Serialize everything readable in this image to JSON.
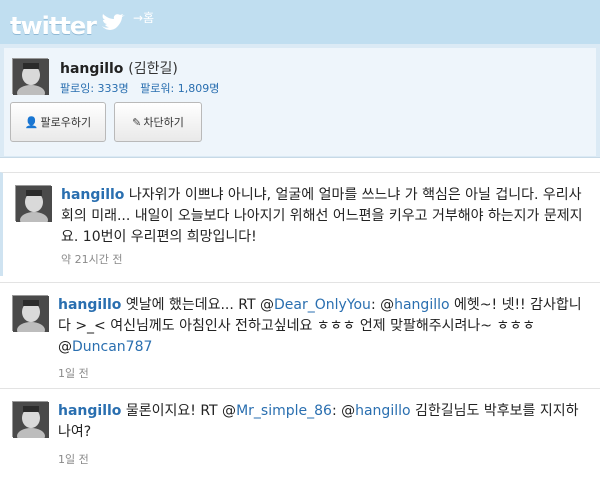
{
  "header": {
    "logo": "twitter",
    "home_link": "→홈"
  },
  "profile": {
    "username": "hangillo",
    "realname": "(김한길)",
    "following": "팔로잉: 333명",
    "followers": "팔로워: 1,809명",
    "follow_button": "팔로우하기",
    "block_button": "차단하기"
  },
  "tweets": [
    {
      "user": "hangillo",
      "parts": [
        "나자위가 이쁘냐 아니냐, 얼굴에 얼마를 쓰느냐 가 핵심은 아닐 겁니다. 우리사회의 미래... 내일이 오늘보다 나아지기 위해선 어느편을 키우고 거부해야 하는지가 문제지요. 10번이 우리편의 희망입니다!"
      ],
      "time": "약 21시간 전"
    },
    {
      "user": "hangillo",
      "text1": "옛날에 했는데요... RT @",
      "mention1": "Dear_OnlyYou",
      "text2": ": @",
      "mention2": "hangillo",
      "text3": " 에헷~! 넷!! 감사합니다 >_< 여신님께도 아침인사 전하고싶네요 ㅎㅎㅎ 언제 맞팔해주시려나~ ㅎㅎㅎ @",
      "mention3": "Duncan787",
      "time": "1일 전"
    },
    {
      "user": "hangillo",
      "text1": "물론이지요! RT @",
      "mention1": "Mr_simple_86",
      "text2": ": @",
      "mention2": "hangillo",
      "text3": " 김한길님도 박후보를 지지하나여?",
      "time": "1일 전"
    }
  ]
}
